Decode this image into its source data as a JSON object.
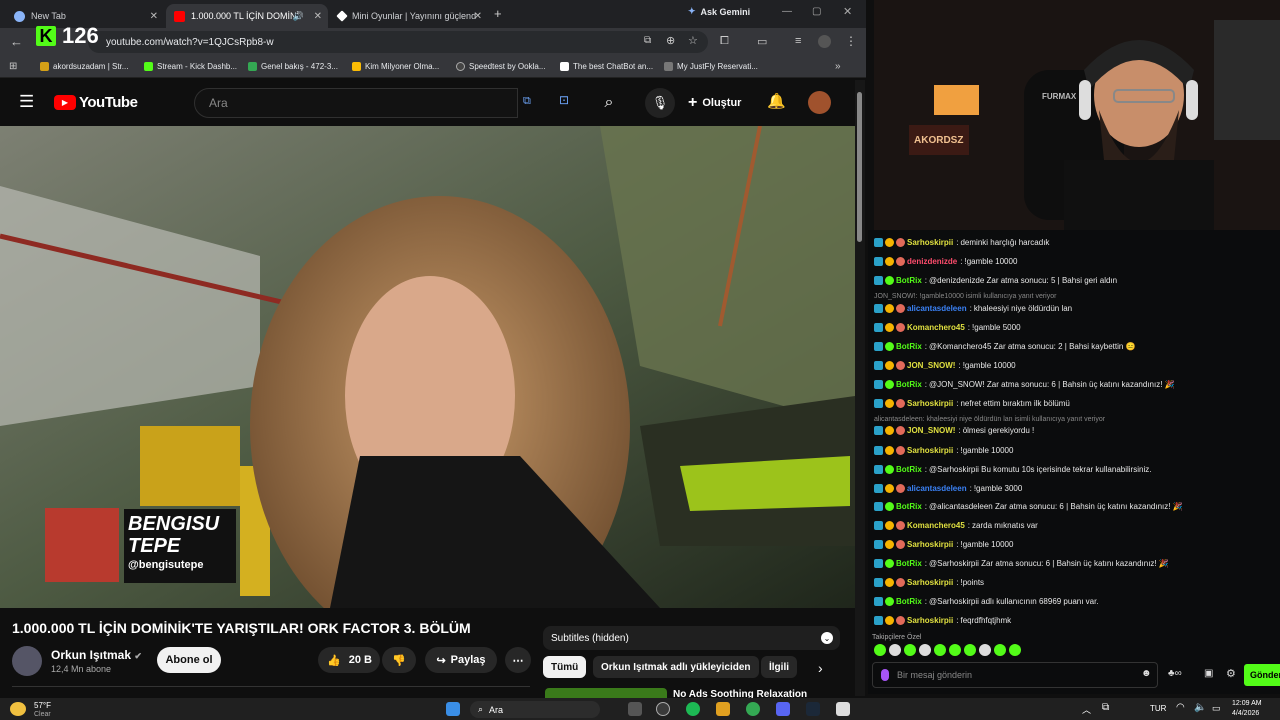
{
  "browser": {
    "tabs": [
      {
        "label": "New Tab"
      },
      {
        "label": "1.000.000 TL İÇİN DOMİNİ"
      },
      {
        "label": "Mini Oyunlar | Yayınını güçlend"
      }
    ],
    "new_tab": "+",
    "ask_gemini": "Ask Gemini",
    "url": "youtube.com/watch?v=1QJCsRpb8-w",
    "bookmarks": [
      "akordsuzadam | Str...",
      "Stream - Kick Dashb...",
      "Genel bakış - 472-3...",
      "Kim Milyoner Olma...",
      "Speedtest by Ookla...",
      "The best ChatBot an...",
      "My JustFly Reservati..."
    ]
  },
  "kick_viewers": "126",
  "youtube": {
    "logo": "YouTube",
    "search_placeholder": "Ara",
    "create_label": "Oluştur",
    "video": {
      "overlay_name_line1": "BENGISU",
      "overlay_name_line2": "TEPE",
      "overlay_handle": "@bengisutepe",
      "title": "1.000.000 TL İÇİN DOMİNİK'TE YARIŞTILAR! ORK FACTOR 3. BÖLÜM",
      "channel": "Orkun Işıtmak",
      "subscribers": "12,4 Mn abone",
      "subscribe_label": "Abone ol",
      "likes": "20 B",
      "share_label": "Paylaş"
    },
    "subtitles": "Subtitles (hidden)",
    "chips": [
      "Tümü",
      "Orkun Işıtmak adlı yükleyiciden",
      "İlgili"
    ],
    "next_video": "No Ads Soothing Relaxation"
  },
  "chat": {
    "messages": [
      {
        "user": "Sarhoskirpii",
        "color": "#e0e040",
        "text": "deminki harçlığı harcadık"
      },
      {
        "user": "denizdenizde",
        "color": "#ff4d6d",
        "text": "!gamble 10000"
      },
      {
        "user": "BotRix",
        "color": "#53fc18",
        "text": "@denizdenizde Zar atma sonucu: 5 | Bahsi geri aldın"
      },
      {
        "reply": "JON_SNOW!: !gamble10000 isimli kullanıcıya yanıt veriyor"
      },
      {
        "user": "alicantasdeleen",
        "color": "#3b82f6",
        "text": "khaleesiyi niye öldürdün lan"
      },
      {
        "user": "Komanchero45",
        "color": "#e0e040",
        "text": "!gamble 5000"
      },
      {
        "user": "BotRix",
        "color": "#53fc18",
        "text": "@Komanchero45 Zar atma sonucu: 2 | Bahsi kaybettin 😑"
      },
      {
        "user": "JON_SNOW!",
        "color": "#e0e040",
        "text": "!gamble 10000"
      },
      {
        "user": "BotRix",
        "color": "#53fc18",
        "text": "@JON_SNOW! Zar atma sonucu: 6 | Bahsin üç katını kazandınız! 🎉"
      },
      {
        "user": "Sarhoskirpii",
        "color": "#e0e040",
        "text": "nefret ettim bıraktım ilk bölümü"
      },
      {
        "reply": "alicantasdeleen: khaleesiyi niye öldürdün lan isimli kullanıcıya yanıt veriyor"
      },
      {
        "user": "JON_SNOW!",
        "color": "#e0e040",
        "text": "ölmesi gerekiyordu !"
      },
      {
        "user": "Sarhoskirpii",
        "color": "#e0e040",
        "text": "!gamble 10000"
      },
      {
        "user": "BotRix",
        "color": "#53fc18",
        "text": "@Sarhoskirpii Bu komutu 10s içerisinde tekrar kullanabilirsiniz."
      },
      {
        "user": "alicantasdeleen",
        "color": "#3b82f6",
        "text": "!gamble 3000"
      },
      {
        "user": "BotRix",
        "color": "#53fc18",
        "text": "@alicantasdeleen Zar atma sonucu: 6 | Bahsin üç katını kazandınız! 🎉"
      },
      {
        "user": "Komanchero45",
        "color": "#e0e040",
        "text": "zarda mıknatıs var"
      },
      {
        "user": "Sarhoskirpii",
        "color": "#e0e040",
        "text": "!gamble 10000"
      },
      {
        "user": "BotRix",
        "color": "#53fc18",
        "text": "@Sarhoskirpii Zar atma sonucu: 6 | Bahsin üç katını kazandınız! 🎉"
      },
      {
        "user": "Sarhoskirpii",
        "color": "#e0e040",
        "text": "!points"
      },
      {
        "user": "BotRix",
        "color": "#53fc18",
        "text": "@Sarhoskirpii adlı kullanıcının 68969 puanı var."
      },
      {
        "user": "Sarhoskirpii",
        "color": "#e0e040",
        "text": "feqrdfhfqtjhmk"
      }
    ],
    "followers_only": "Takipçilere Özel",
    "input_placeholder": "Bir mesaj gönderin",
    "send_label": "Gönder"
  },
  "cam": {
    "sign": "AKORDSZ",
    "chair_brand": "FURMAX"
  },
  "taskbar": {
    "temperature": "57°F",
    "weather": "Clear",
    "search": "Ara",
    "language": "TUR",
    "time": "12:09 AM",
    "date": "4/4/2026"
  },
  "colors": {
    "accent": "#ff0000",
    "kick_green": "#53fc18"
  }
}
